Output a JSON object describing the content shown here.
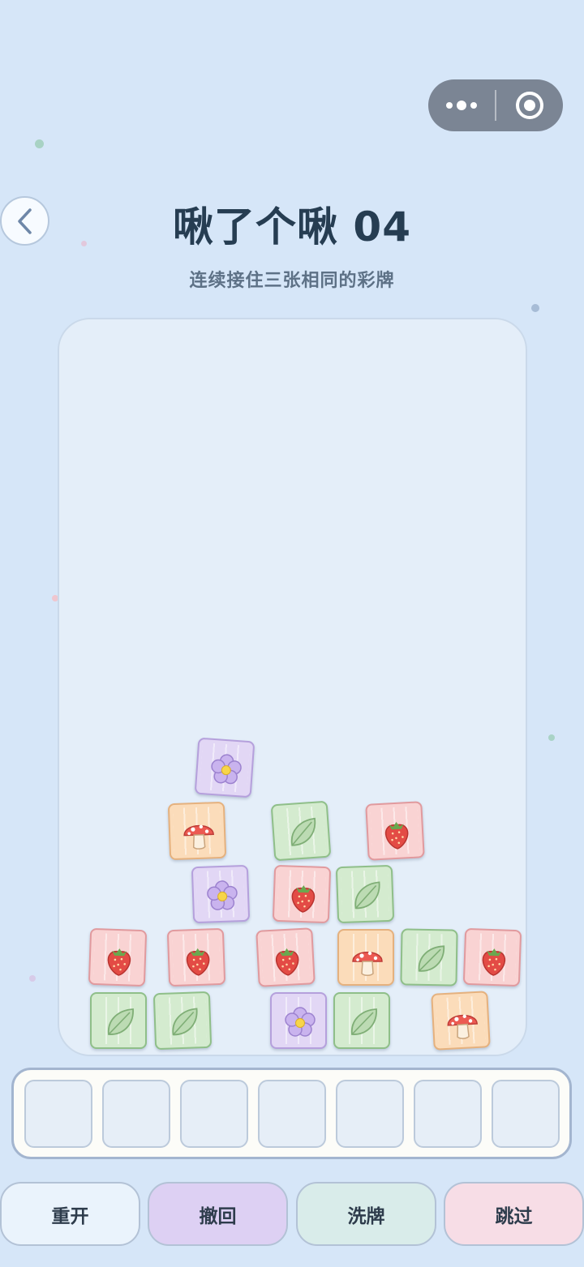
{
  "header": {
    "title": "啾了个啾 04",
    "subtitle": "连续接住三张相同的彩牌"
  },
  "capsule": {
    "more_icon": "more-dots-icon",
    "close_icon": "target-circle-icon"
  },
  "colors": {
    "background": "#d6e6f8",
    "board": "#e4eef9",
    "title": "#263d52",
    "red_tile": "#f9d3d3",
    "green_tile": "#d4ebcf",
    "purple_tile": "#e2d7f5",
    "orange_tile": "#fbdcba"
  },
  "board": {
    "tile_types": [
      "strawberry",
      "leaf",
      "flower",
      "mushroom"
    ],
    "tiles_by_row": [
      [
        "flower"
      ],
      [
        "mushroom",
        "leaf",
        "strawberry"
      ],
      [
        "flower",
        "strawberry",
        "leaf"
      ],
      [
        "strawberry",
        "strawberry",
        "strawberry",
        "mushroom",
        "leaf",
        "strawberry"
      ],
      [
        "leaf",
        "leaf",
        "flower",
        "leaf",
        "mushroom"
      ]
    ]
  },
  "tray": {
    "slot_count": 7,
    "slots_filled": 0
  },
  "buttons": [
    {
      "label": "重开",
      "color": "#eaf3fc"
    },
    {
      "label": "撤回",
      "color": "#ddd0f3"
    },
    {
      "label": "洗牌",
      "color": "#d9ecea"
    },
    {
      "label": "跳过",
      "color": "#f7dde6"
    }
  ]
}
